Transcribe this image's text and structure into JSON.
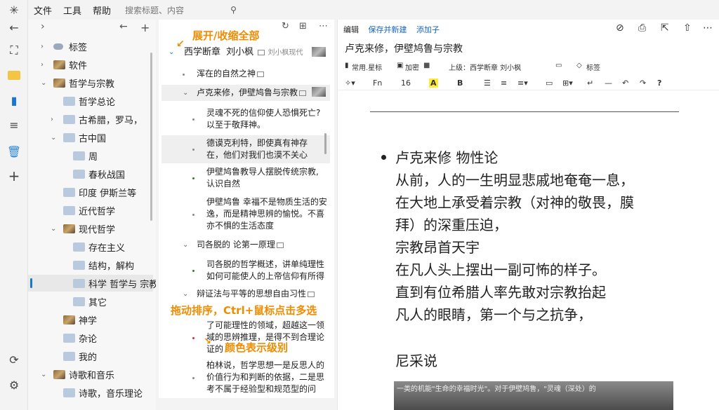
{
  "menu": {
    "file": "文件",
    "tools": "工具",
    "help": "帮助",
    "search_placeholder": "搜索标题、内容"
  },
  "tree": {
    "items": [
      {
        "label": "标签",
        "icon": "tag-icon"
      },
      {
        "label": "软件",
        "icon": "image-icon"
      },
      {
        "label": "哲学与宗教",
        "icon": "image-icon"
      },
      {
        "label": "哲学总论",
        "icon": "folder-icon"
      },
      {
        "label": "古希腊，罗马，",
        "icon": "folder-icon"
      },
      {
        "label": "古中国",
        "icon": "folder-icon"
      },
      {
        "label": "周",
        "icon": "folder-icon"
      },
      {
        "label": "春秋战国",
        "icon": "folder-icon"
      },
      {
        "label": "印度 伊斯兰等",
        "icon": "folder-icon"
      },
      {
        "label": "近代哲学",
        "icon": "folder-icon"
      },
      {
        "label": "现代哲学",
        "icon": "image-icon"
      },
      {
        "label": "存在主义",
        "icon": "folder-icon"
      },
      {
        "label": "结构，解构",
        "icon": "folder-icon"
      },
      {
        "label": "科学 哲学与 宗教",
        "icon": "folder-icon"
      },
      {
        "label": "其它",
        "icon": "folder-icon"
      },
      {
        "label": "神学",
        "icon": "image-icon"
      },
      {
        "label": "杂论",
        "icon": "folder-icon"
      },
      {
        "label": "我的",
        "icon": "folder-icon"
      },
      {
        "label": "诗歌和音乐",
        "icon": "image-icon"
      },
      {
        "label": "诗歌，音乐理论",
        "icon": "folder-icon"
      }
    ]
  },
  "outline": {
    "root": {
      "title": "西学断章",
      "author": "刘小枫",
      "sub": "刘小枫现代"
    },
    "items": [
      {
        "text": "浑在的自然之神"
      },
      {
        "text": "卢克来修，伊壁鸠鲁与宗教"
      },
      {
        "l1": "灵魂不死的信仰使人恐惧死亡?",
        "l2": "以至于敬拜神。"
      },
      {
        "l1": "德谟克利特，即使真有神存",
        "l2": "在，他们对我们也漠不关心"
      },
      {
        "l1": "伊壁鸠鲁教导人摆脱传统宗教,",
        "l2": "认识自然"
      },
      {
        "l1": "伊壁鸠鲁 幸福不是物质生活的安",
        "l2": "逸，而是精神思辨的愉悦。不喜",
        "l3": "亦不惧的生活态度"
      },
      {
        "text": "司各脱的 论第一原理"
      },
      {
        "l1": "司各脱的哲学概述，讲单纯理性",
        "l2": "如何可能使人的上帝信仰有所得"
      },
      {
        "text": "辩证法与平等的思想自由习性"
      },
      {
        "l1": "了可能理性的领域，超越这一领",
        "l2": "域的思辨推理，是得不到合理论",
        "l3": "证的"
      },
      {
        "l1": "柏林说，哲学思想一是反思人的",
        "l2": "价值行为和判断的依据，二是思",
        "l3": "考不属于经验型和规范型的问"
      }
    ],
    "annotations": {
      "expand": "展开/收缩全部",
      "drag": "拖动排序，Ctrl+鼠标点击多选",
      "color": "颜色表示级别"
    }
  },
  "editor": {
    "tabs": {
      "edit": "编辑",
      "save_new": "保存并新建",
      "add_child": "添加子"
    },
    "title": "卢克来修，伊壁鸠鲁与宗教",
    "meta": {
      "star": "常用.星标",
      "encrypt": "加密",
      "parent": "上级：西学断章  刘小枫",
      "tags": "标签"
    },
    "toolbar": {
      "font": "Fn",
      "size": "16",
      "bold": "B"
    },
    "body": {
      "lines": [
        "卢克来修 物性论",
        "从前，人的一生明显悲戚地奄奄一息，",
        "在大地上承受着宗教（对神的敬畏，膜",
        "拜）的深重压迫，",
        "宗教昂首天宇",
        "在凡人头上摆出一副可怖的样子。",
        "直到有位希腊人率先敢对宗教抬起",
        "凡人的眼睛，第一个与之抗争，",
        "",
        "尼采说"
      ],
      "photo_caption": "一类的机能\"生命的幸福时光\"。对于伊壁鸠鲁，\"灵魂（深处）的"
    }
  }
}
